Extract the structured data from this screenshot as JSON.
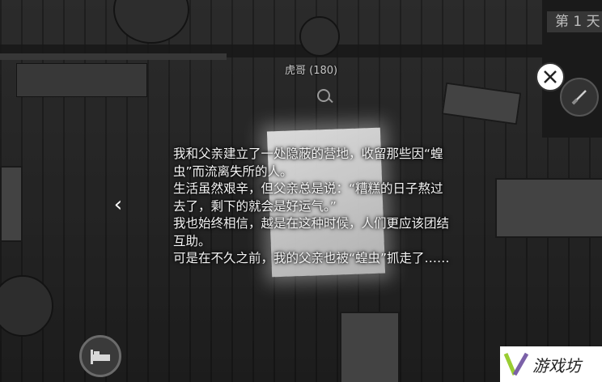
{
  "hud": {
    "day_label": "第 1 天",
    "npc_name": "虎哥 (180)"
  },
  "dialogue": {
    "lines": [
      "我和父亲建立了一处隐蔽的营地，收留那些因“蝗",
      "虫”而流离失所的人。",
      "生活虽然艰辛，但父亲总是说：“糟糕的日子熬过",
      "去了，剩下的就会是好运气。”",
      "我也始终相信，越是在这种时候，人们更应该团结",
      "互助。",
      "可是在不久之前，我的父亲也被“蝗虫”抓走了……"
    ]
  },
  "controls": {
    "back_symbol": "‹"
  },
  "watermark": {
    "text": "游戏坊"
  },
  "icons": {
    "close": "close-icon",
    "back": "chevron-left-icon",
    "tool": "knife-icon",
    "bed": "bed-icon",
    "zoom": "zoom-in-icon"
  }
}
